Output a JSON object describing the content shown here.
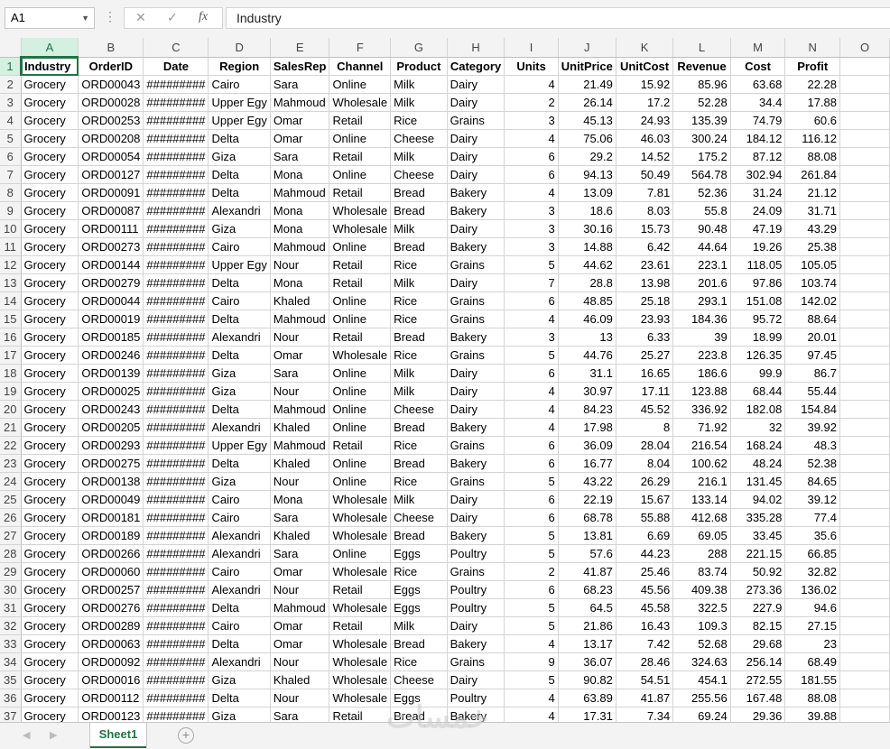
{
  "namebox": "A1",
  "formula": "Industry",
  "icons": {
    "cancel": "✕",
    "enter": "✓",
    "fx": "fx"
  },
  "columns": [
    "A",
    "B",
    "C",
    "D",
    "E",
    "F",
    "G",
    "H",
    "I",
    "J",
    "K",
    "L",
    "M",
    "N",
    "O"
  ],
  "headers": [
    "Industry",
    "OrderID",
    "Date",
    "Region",
    "SalesRep",
    "Channel",
    "Product",
    "Category",
    "Units",
    "UnitPrice",
    "UnitCost",
    "Revenue",
    "Cost",
    "Profit"
  ],
  "rows": [
    [
      "Grocery",
      "ORD00043",
      "#########",
      "Cairo",
      "Sara",
      "Online",
      "Milk",
      "Dairy",
      "4",
      "21.49",
      "15.92",
      "85.96",
      "63.68",
      "22.28"
    ],
    [
      "Grocery",
      "ORD00028",
      "#########",
      "Upper Egy",
      "Mahmoud",
      "Wholesale",
      "Milk",
      "Dairy",
      "2",
      "26.14",
      "17.2",
      "52.28",
      "34.4",
      "17.88"
    ],
    [
      "Grocery",
      "ORD00253",
      "#########",
      "Upper Egy",
      "Omar",
      "Retail",
      "Rice",
      "Grains",
      "3",
      "45.13",
      "24.93",
      "135.39",
      "74.79",
      "60.6"
    ],
    [
      "Grocery",
      "ORD00208",
      "#########",
      "Delta",
      "Omar",
      "Online",
      "Cheese",
      "Dairy",
      "4",
      "75.06",
      "46.03",
      "300.24",
      "184.12",
      "116.12"
    ],
    [
      "Grocery",
      "ORD00054",
      "#########",
      "Giza",
      "Sara",
      "Retail",
      "Milk",
      "Dairy",
      "6",
      "29.2",
      "14.52",
      "175.2",
      "87.12",
      "88.08"
    ],
    [
      "Grocery",
      "ORD00127",
      "#########",
      "Delta",
      "Mona",
      "Online",
      "Cheese",
      "Dairy",
      "6",
      "94.13",
      "50.49",
      "564.78",
      "302.94",
      "261.84"
    ],
    [
      "Grocery",
      "ORD00091",
      "#########",
      "Delta",
      "Mahmoud",
      "Retail",
      "Bread",
      "Bakery",
      "4",
      "13.09",
      "7.81",
      "52.36",
      "31.24",
      "21.12"
    ],
    [
      "Grocery",
      "ORD00087",
      "#########",
      "Alexandri",
      "Mona",
      "Wholesale",
      "Bread",
      "Bakery",
      "3",
      "18.6",
      "8.03",
      "55.8",
      "24.09",
      "31.71"
    ],
    [
      "Grocery",
      "ORD00111",
      "#########",
      "Giza",
      "Mona",
      "Wholesale",
      "Milk",
      "Dairy",
      "3",
      "30.16",
      "15.73",
      "90.48",
      "47.19",
      "43.29"
    ],
    [
      "Grocery",
      "ORD00273",
      "#########",
      "Cairo",
      "Mahmoud",
      "Online",
      "Bread",
      "Bakery",
      "3",
      "14.88",
      "6.42",
      "44.64",
      "19.26",
      "25.38"
    ],
    [
      "Grocery",
      "ORD00144",
      "#########",
      "Upper Egy",
      "Nour",
      "Retail",
      "Rice",
      "Grains",
      "5",
      "44.62",
      "23.61",
      "223.1",
      "118.05",
      "105.05"
    ],
    [
      "Grocery",
      "ORD00279",
      "#########",
      "Delta",
      "Mona",
      "Retail",
      "Milk",
      "Dairy",
      "7",
      "28.8",
      "13.98",
      "201.6",
      "97.86",
      "103.74"
    ],
    [
      "Grocery",
      "ORD00044",
      "#########",
      "Cairo",
      "Khaled",
      "Online",
      "Rice",
      "Grains",
      "6",
      "48.85",
      "25.18",
      "293.1",
      "151.08",
      "142.02"
    ],
    [
      "Grocery",
      "ORD00019",
      "#########",
      "Delta",
      "Mahmoud",
      "Online",
      "Rice",
      "Grains",
      "4",
      "46.09",
      "23.93",
      "184.36",
      "95.72",
      "88.64"
    ],
    [
      "Grocery",
      "ORD00185",
      "#########",
      "Alexandri",
      "Nour",
      "Retail",
      "Bread",
      "Bakery",
      "3",
      "13",
      "6.33",
      "39",
      "18.99",
      "20.01"
    ],
    [
      "Grocery",
      "ORD00246",
      "#########",
      "Delta",
      "Omar",
      "Wholesale",
      "Rice",
      "Grains",
      "5",
      "44.76",
      "25.27",
      "223.8",
      "126.35",
      "97.45"
    ],
    [
      "Grocery",
      "ORD00139",
      "#########",
      "Giza",
      "Sara",
      "Online",
      "Milk",
      "Dairy",
      "6",
      "31.1",
      "16.65",
      "186.6",
      "99.9",
      "86.7"
    ],
    [
      "Grocery",
      "ORD00025",
      "#########",
      "Giza",
      "Nour",
      "Online",
      "Milk",
      "Dairy",
      "4",
      "30.97",
      "17.11",
      "123.88",
      "68.44",
      "55.44"
    ],
    [
      "Grocery",
      "ORD00243",
      "#########",
      "Delta",
      "Mahmoud",
      "Online",
      "Cheese",
      "Dairy",
      "4",
      "84.23",
      "45.52",
      "336.92",
      "182.08",
      "154.84"
    ],
    [
      "Grocery",
      "ORD00205",
      "#########",
      "Alexandri",
      "Khaled",
      "Online",
      "Bread",
      "Bakery",
      "4",
      "17.98",
      "8",
      "71.92",
      "32",
      "39.92"
    ],
    [
      "Grocery",
      "ORD00293",
      "#########",
      "Upper Egy",
      "Mahmoud",
      "Retail",
      "Rice",
      "Grains",
      "6",
      "36.09",
      "28.04",
      "216.54",
      "168.24",
      "48.3"
    ],
    [
      "Grocery",
      "ORD00275",
      "#########",
      "Delta",
      "Khaled",
      "Online",
      "Bread",
      "Bakery",
      "6",
      "16.77",
      "8.04",
      "100.62",
      "48.24",
      "52.38"
    ],
    [
      "Grocery",
      "ORD00138",
      "#########",
      "Giza",
      "Nour",
      "Online",
      "Rice",
      "Grains",
      "5",
      "43.22",
      "26.29",
      "216.1",
      "131.45",
      "84.65"
    ],
    [
      "Grocery",
      "ORD00049",
      "#########",
      "Cairo",
      "Mona",
      "Wholesale",
      "Milk",
      "Dairy",
      "6",
      "22.19",
      "15.67",
      "133.14",
      "94.02",
      "39.12"
    ],
    [
      "Grocery",
      "ORD00181",
      "#########",
      "Cairo",
      "Sara",
      "Wholesale",
      "Cheese",
      "Dairy",
      "6",
      "68.78",
      "55.88",
      "412.68",
      "335.28",
      "77.4"
    ],
    [
      "Grocery",
      "ORD00189",
      "#########",
      "Alexandri",
      "Khaled",
      "Wholesale",
      "Bread",
      "Bakery",
      "5",
      "13.81",
      "6.69",
      "69.05",
      "33.45",
      "35.6"
    ],
    [
      "Grocery",
      "ORD00266",
      "#########",
      "Alexandri",
      "Sara",
      "Online",
      "Eggs",
      "Poultry",
      "5",
      "57.6",
      "44.23",
      "288",
      "221.15",
      "66.85"
    ],
    [
      "Grocery",
      "ORD00060",
      "#########",
      "Cairo",
      "Omar",
      "Wholesale",
      "Rice",
      "Grains",
      "2",
      "41.87",
      "25.46",
      "83.74",
      "50.92",
      "32.82"
    ],
    [
      "Grocery",
      "ORD00257",
      "#########",
      "Alexandri",
      "Nour",
      "Retail",
      "Eggs",
      "Poultry",
      "6",
      "68.23",
      "45.56",
      "409.38",
      "273.36",
      "136.02"
    ],
    [
      "Grocery",
      "ORD00276",
      "#########",
      "Delta",
      "Mahmoud",
      "Wholesale",
      "Eggs",
      "Poultry",
      "5",
      "64.5",
      "45.58",
      "322.5",
      "227.9",
      "94.6"
    ],
    [
      "Grocery",
      "ORD00289",
      "#########",
      "Cairo",
      "Omar",
      "Retail",
      "Milk",
      "Dairy",
      "5",
      "21.86",
      "16.43",
      "109.3",
      "82.15",
      "27.15"
    ],
    [
      "Grocery",
      "ORD00063",
      "#########",
      "Delta",
      "Omar",
      "Wholesale",
      "Bread",
      "Bakery",
      "4",
      "13.17",
      "7.42",
      "52.68",
      "29.68",
      "23"
    ],
    [
      "Grocery",
      "ORD00092",
      "#########",
      "Alexandri",
      "Nour",
      "Wholesale",
      "Rice",
      "Grains",
      "9",
      "36.07",
      "28.46",
      "324.63",
      "256.14",
      "68.49"
    ],
    [
      "Grocery",
      "ORD00016",
      "#########",
      "Giza",
      "Khaled",
      "Wholesale",
      "Cheese",
      "Dairy",
      "5",
      "90.82",
      "54.51",
      "454.1",
      "272.55",
      "181.55"
    ],
    [
      "Grocery",
      "ORD00112",
      "#########",
      "Delta",
      "Nour",
      "Wholesale",
      "Eggs",
      "Poultry",
      "4",
      "63.89",
      "41.87",
      "255.56",
      "167.48",
      "88.08"
    ],
    [
      "Grocery",
      "ORD00123",
      "#########",
      "Giza",
      "Sara",
      "Retail",
      "Bread",
      "Bakery",
      "4",
      "17.31",
      "7.34",
      "69.24",
      "29.36",
      "39.88"
    ]
  ],
  "sheet_tab": "Sheet1",
  "add_sheet": "+",
  "nav": {
    "prev": "◀",
    "next": "▶"
  },
  "watermark": "خمسات",
  "accent_color": "#217346"
}
